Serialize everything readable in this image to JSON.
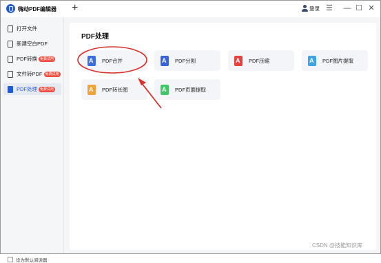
{
  "app": {
    "title": "嗨动PDF编辑器"
  },
  "header": {
    "new_tab_symbol": "+",
    "login_label": "登录"
  },
  "window_controls": {
    "menu": "☰",
    "minimize": "—",
    "maximize": "☐",
    "close": "✕"
  },
  "sidebar": {
    "items": [
      {
        "label": "打开文件",
        "badge": ""
      },
      {
        "label": "新建空白PDF",
        "badge": ""
      },
      {
        "label": "PDF转换",
        "badge": "免费试用"
      },
      {
        "label": "文件转PDF",
        "badge": "免费试用"
      },
      {
        "label": "PDF处理",
        "badge": "免费试用",
        "active": true
      }
    ],
    "default_reader_label": "设为默认阅读器"
  },
  "main": {
    "section_title": "PDF处理",
    "tools": [
      {
        "label": "PDF合并",
        "color": "#3b6fe0"
      },
      {
        "label": "PDF分割",
        "color": "#3a63d8"
      },
      {
        "label": "PDF压缩",
        "color": "#e2443d"
      },
      {
        "label": "PDF图片提取",
        "color": "#3da4e6"
      },
      {
        "label": "PDF转长图",
        "color": "#f2a23b"
      },
      {
        "label": "PDF页面提取",
        "color": "#3fc768"
      }
    ]
  },
  "annotation": {
    "highlight_color": "#d9302a"
  },
  "watermark": "CSDN @技能知识库"
}
